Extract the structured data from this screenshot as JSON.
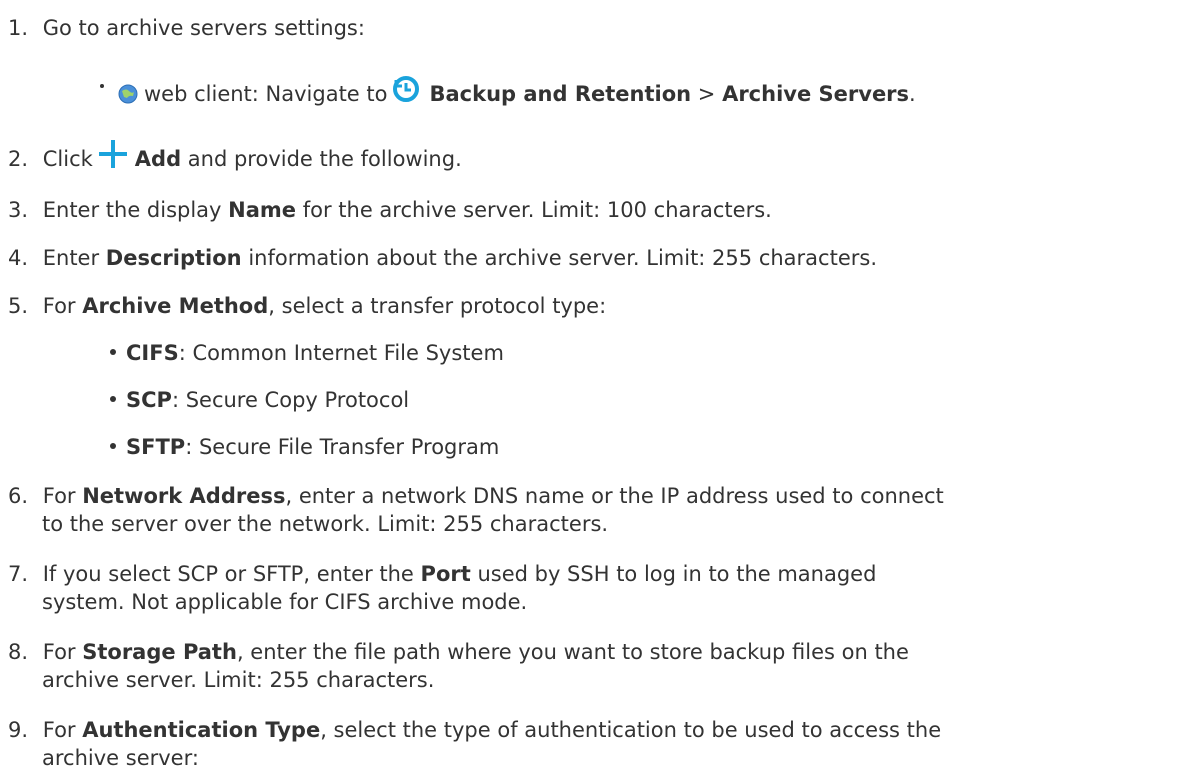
{
  "colors": {
    "text": "#333333",
    "accent": "#1aa3dc"
  },
  "icons": {
    "web_client": "globe-icon",
    "backup": "clock-icon",
    "add": "plus-icon"
  },
  "steps": {
    "s1": {
      "num": "1.",
      "text": "Go to archive servers settings:"
    },
    "s1_sub": {
      "pre": "web client: Navigate to",
      "bold1": "Backup and Retention",
      "sep": ">",
      "bold2": "Archive Servers",
      "end": "."
    },
    "s2": {
      "num": "2.",
      "pre": "Click",
      "bold": "Add",
      "post": "and provide the following."
    },
    "s3": {
      "num": "3.",
      "pre": "Enter the display",
      "bold": "Name",
      "post": "for the archive server. Limit: 100 characters."
    },
    "s4": {
      "num": "4.",
      "pre": "Enter",
      "bold": "Description",
      "post": "information about the archive server. Limit: 255 characters."
    },
    "s5": {
      "num": "5.",
      "pre": "For",
      "bold": "Archive Method",
      "post": ", select a transfer protocol type:"
    },
    "methods": [
      {
        "bold": "CIFS",
        "text": ": Common Internet File System"
      },
      {
        "bold": "SCP",
        "text": ": Secure Copy Protocol"
      },
      {
        "bold": "SFTP",
        "text": ": Secure File Transfer Program"
      }
    ],
    "s6": {
      "num": "6.",
      "pre": "For",
      "bold": "Network Address",
      "post": ", enter a network DNS name or the IP address used to connect",
      "line2": "to the server over the network. Limit: 255 characters."
    },
    "s7": {
      "num": "7.",
      "pre": "If you select SCP or SFTP, enter the",
      "bold": "Port",
      "post": "used by SSH to log in to the managed",
      "line2": "system. Not applicable for CIFS archive mode."
    },
    "s8": {
      "num": "8.",
      "pre": "For",
      "bold": "Storage Path",
      "post": ", enter the file path where you want to store backup files on the",
      "line2": "archive server. Limit: 255 characters."
    },
    "s9": {
      "num": "9.",
      "pre": "For",
      "bold": "Authentication Type",
      "post": ", select the type of authentication to be used to access the",
      "line2": "archive server:"
    }
  }
}
